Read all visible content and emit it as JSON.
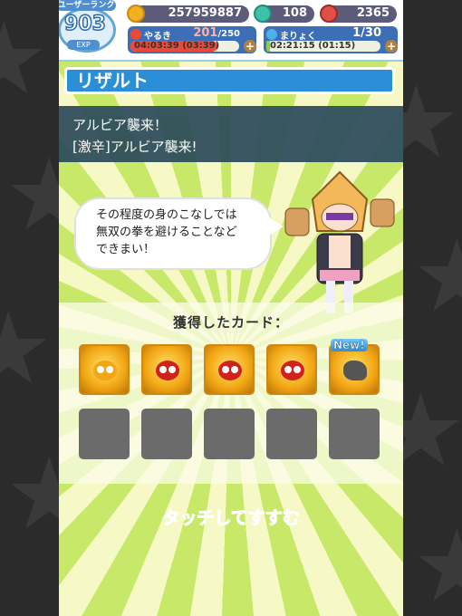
{
  "header": {
    "rank_label": "ユーザーランク",
    "rank_value": "903",
    "exp_label": "EXP",
    "coins": "257959887",
    "gems": "108",
    "tickets": "2365",
    "stamina": {
      "name": "やるき",
      "value": "201",
      "max": "/250",
      "timer": "04:03:39 (03:39)",
      "fill": 0.8,
      "color": "#e94a3a"
    },
    "magic": {
      "name": "まりょく",
      "value": "1/30",
      "timer": "02:21:15 (01:15)",
      "fill": 0.03,
      "color": "#8cd04a"
    }
  },
  "result": {
    "title": "リザルト",
    "quest_line1": "アルビア襲来！",
    "quest_line2": "[激辛]アルビア襲来!",
    "dialog": [
      "その程度の身のこなしでは",
      "無双の拳を避けることなど",
      "できまい！"
    ]
  },
  "cards": {
    "title": "獲得したカード：",
    "items": [
      {
        "icon": "star-puyo-icon",
        "color": "#f2a614",
        "is_new": false
      },
      {
        "icon": "red-puyo-icon",
        "color": "#d0221a",
        "is_new": false
      },
      {
        "icon": "red-puyo-icon",
        "color": "#d0221a",
        "is_new": false
      },
      {
        "icon": "red-puyo-icon",
        "color": "#d0221a",
        "is_new": false
      },
      {
        "icon": "rock-icon",
        "color": "#555555",
        "is_new": true
      }
    ],
    "new_label": "New!",
    "empty_slots": 5
  },
  "touch_prompt": "タッチしてすすむ"
}
